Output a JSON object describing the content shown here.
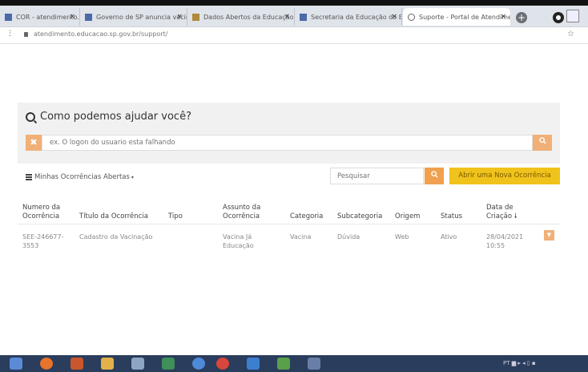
{
  "browser": {
    "tabs": [
      {
        "title": "COR - atendimento.p"
      },
      {
        "title": "Governo de SP anuncia vacin"
      },
      {
        "title": "Dados Abertos da Educação"
      },
      {
        "title": "Secretaria da Educação do Est"
      },
      {
        "title": "Suporte - Portal de Atendimen"
      }
    ],
    "url": "atendimento.educacao.sp.gov.br/support/"
  },
  "help": {
    "title": "Como podemos ajudar você?",
    "placeholder": "ex. O logon do usuario esta falhando"
  },
  "toolbar": {
    "filter_label": "Minhas Ocorrências Abertas",
    "search_placeholder": "Pesquisar",
    "new_button": "Abrir uma Nova Ocorrência"
  },
  "table": {
    "headers": {
      "numero_l1": "Numero da",
      "numero_l2": "Ocorrência",
      "titulo": "Título da Ocorrência",
      "tipo": "Tipo",
      "assunto_l1": "Assunto da",
      "assunto_l2": "Ocorrência",
      "categoria": "Categoria",
      "subcategoria": "Subcategoria",
      "origem": "Origem",
      "status": "Status",
      "data_l1": "Data de",
      "data_l2": "Criação"
    },
    "rows": [
      {
        "numero_l1": "SEE-246677-",
        "numero_l2": "3553",
        "titulo": "Cadastro da Vacinação",
        "tipo": "",
        "assunto_l1": "Vacina Já",
        "assunto_l2": "Educação",
        "categoria": "Vacina",
        "subcategoria": "Dúvida",
        "origem": "Web",
        "status": "Ativo",
        "data_l1": "28/04/2021",
        "data_l2": "10:55"
      }
    ]
  },
  "taskbar": {
    "tray_text": "PT"
  },
  "colors": {
    "accent_orange": "#f0b078",
    "button_yellow": "#f0c21c",
    "taskbar": "#2a3d5c"
  }
}
